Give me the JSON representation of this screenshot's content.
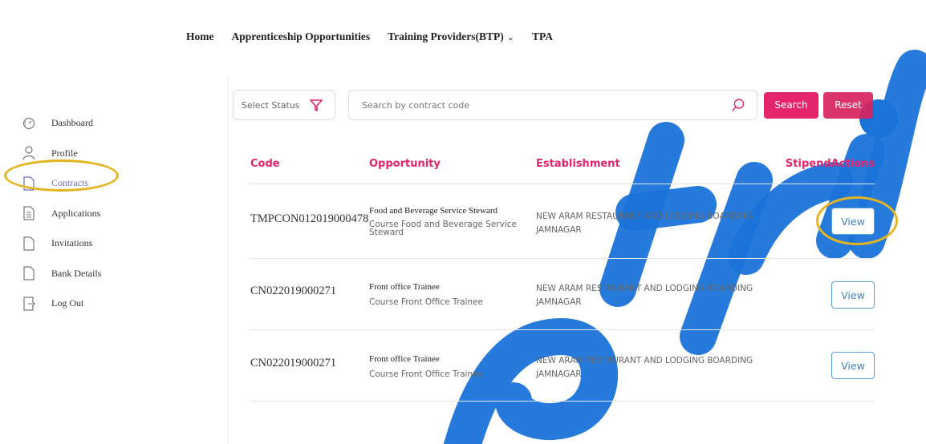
{
  "nav": {
    "home": "Home",
    "apprenticeship": "Apprenticeship Opportunities",
    "training_providers": "Training Providers(BTP)",
    "tpa": "TPA"
  },
  "sidebar": {
    "items": [
      {
        "label": "Dashboard",
        "icon": "dashboard-icon"
      },
      {
        "label": "Profile",
        "icon": "user-icon"
      },
      {
        "label": "Contracts",
        "icon": "document-icon",
        "active": true
      },
      {
        "label": "Applications",
        "icon": "document-lines-icon"
      },
      {
        "label": "Invitations",
        "icon": "document-icon"
      },
      {
        "label": "Bank Details",
        "icon": "document-icon"
      },
      {
        "label": "Log Out",
        "icon": "logout-icon"
      }
    ]
  },
  "filters": {
    "select_status": "Select Status",
    "search_placeholder": "Search by contract code",
    "search_label": "Search",
    "reset_label": "Reset"
  },
  "table": {
    "headers": {
      "code": "Code",
      "opportunity": "Opportunity",
      "establishment": "Establishment",
      "stipend_actions": "StipendActions"
    },
    "rows": [
      {
        "code": "TMPCON012019000478",
        "title": "Food and Beverage Service Steward",
        "course": "Course Food and Beverage Service Steward",
        "establishment": "NEW ARAM RESTAURANT AND LODGING BOARDING JAMNAGAR",
        "action": "View"
      },
      {
        "code": "CN022019000271",
        "title": "Front office Trainee",
        "course": "Course Front Office Trainee",
        "establishment": "NEW ARAM RESTAURANT AND LODGING BOARDING JAMNAGAR",
        "action": "View"
      },
      {
        "code": "CN022019000271",
        "title": "Front office Trainee",
        "course": "Course Front Office Trainee",
        "establishment": "NEW ARAM RESTAURANT AND LODGING BOARDING JAMNAGAR",
        "action": "View"
      }
    ]
  },
  "colors": {
    "accent": "#e6246c",
    "link": "#3b7fc4",
    "highlight_ring": "#e5b520",
    "watermark": "#1a73d9"
  }
}
